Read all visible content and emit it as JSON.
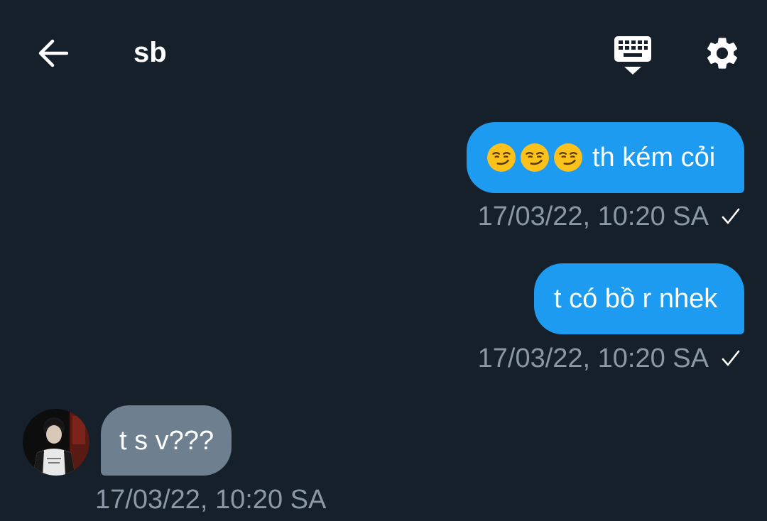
{
  "header": {
    "title": "sb",
    "back_icon": "arrow-left-icon",
    "keyboard_icon": "keyboard-hide-icon",
    "settings_icon": "gear-icon"
  },
  "messages": [
    {
      "direction": "outgoing",
      "emoji": [
        "😏",
        "😏",
        "😏"
      ],
      "text": "th kém cỏi",
      "timestamp": "17/03/22, 10:20 SA",
      "status": "sent-check"
    },
    {
      "direction": "outgoing",
      "text": "t có bồ r nhek",
      "timestamp": "17/03/22, 10:20 SA",
      "status": "sent-check"
    },
    {
      "direction": "incoming",
      "text": "t s v???",
      "timestamp": "17/03/22, 10:20 SA",
      "avatar": "avatar"
    }
  ],
  "colors": {
    "background": "#15202b",
    "outgoing_bubble": "#1d9bf0",
    "incoming_bubble": "#6e7f8f",
    "meta_text": "#8b98a5"
  }
}
